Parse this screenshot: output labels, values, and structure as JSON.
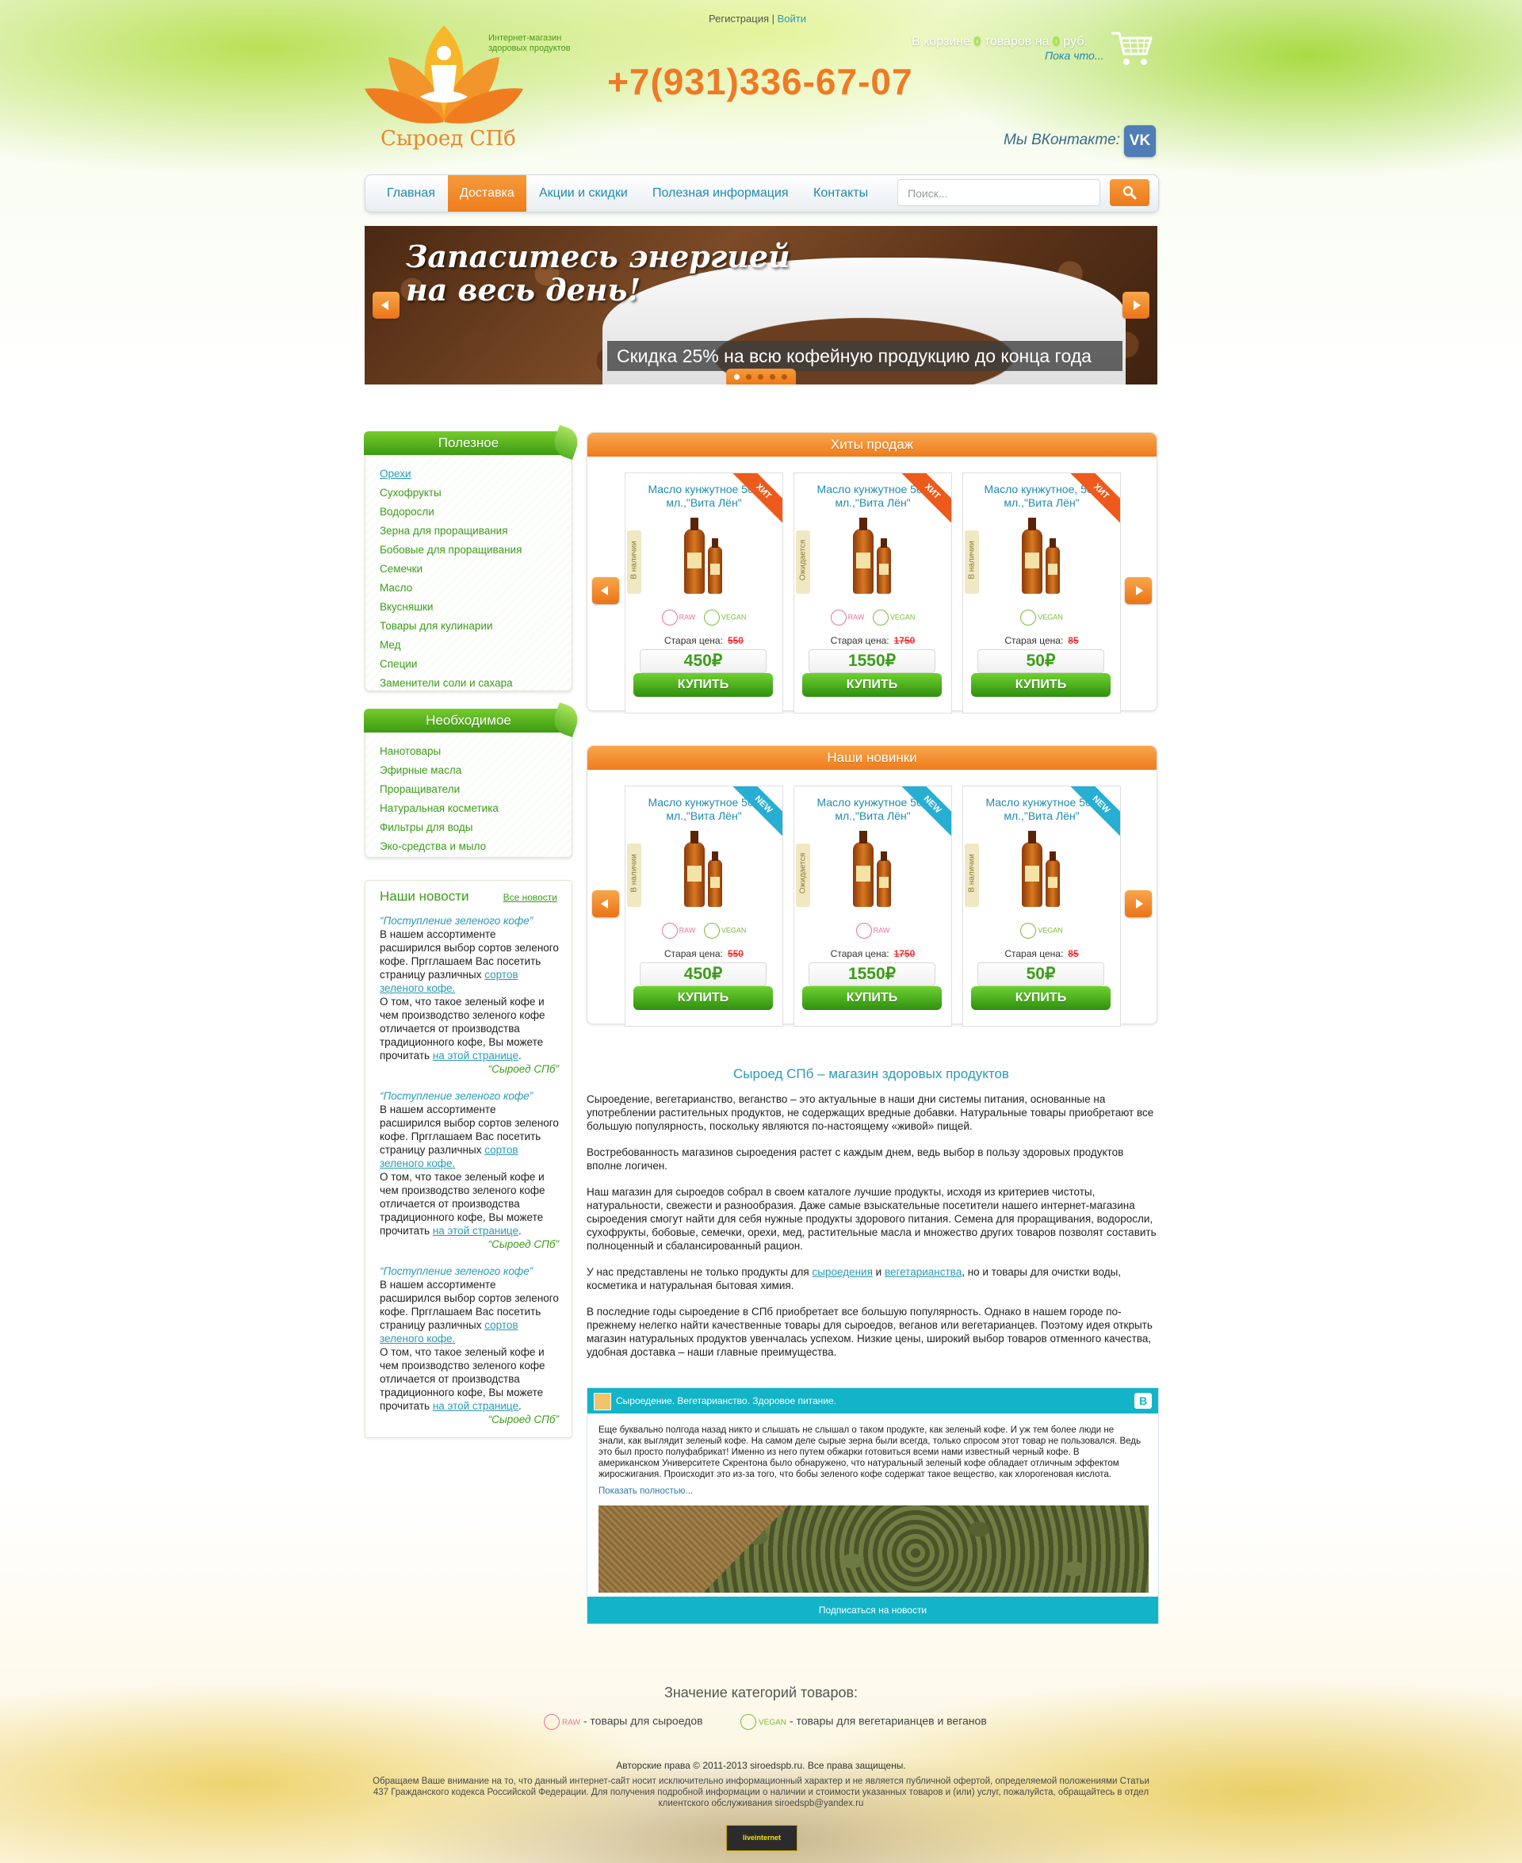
{
  "header": {
    "tagline": "Интернет-магазин здоровых продуктов",
    "brand_name": "Сыроед СПб",
    "register_label": "Регистрация",
    "separator": "|",
    "login_label": "Войти",
    "phone": "+7(931)336-67-07",
    "cart": {
      "prefix": "В корзине",
      "items_count": "0",
      "middle": "товаров на",
      "sum": "0",
      "suffix": "руб.",
      "subtext": "Пока что..."
    },
    "vk_label": "Мы ВКонтакте:",
    "vk_icon_text": "VK"
  },
  "nav": {
    "items": [
      {
        "label": "Главная"
      },
      {
        "label": "Доставка"
      },
      {
        "label": "Акции и скидки"
      },
      {
        "label": "Полезная информация"
      },
      {
        "label": "Контакты"
      }
    ],
    "active_index": 1,
    "search_placeholder": "Поиск..."
  },
  "banner": {
    "title_line1": "Запаситесь энергией",
    "title_line2": "на весь день!",
    "caption": "Скидка 25% на всю кофейную продукцию до конца года",
    "slide_count": 5,
    "active_slide": 0
  },
  "sidebar": {
    "useful": {
      "title": "Полезное",
      "items": [
        "Орехи",
        "Сухофрукты",
        "Водоросли",
        "Зерна для проращивания",
        "Бобовые для проращивания",
        "Семечки",
        "Масло",
        "Вкусняшки",
        "Товары для кулинарии",
        "Мед",
        "Специи",
        "Заменители соли и сахара"
      ]
    },
    "needed": {
      "title": "Необходимое",
      "items": [
        "Нанотовары",
        "Эфирные масла",
        "Проращиватели",
        "Натуральная косметика",
        "Фильтры для воды",
        "Эко-средства и мыло"
      ]
    },
    "news": {
      "title": "Наши новости",
      "all_link": "Все новости",
      "items": [
        {
          "headline": "“Поступление зеленого кофе”",
          "text1": "В нашем ассортименте расширился выбор сортов зеленого кофе. Пргглашаем Вас посетить страницу различных",
          "link1": "сортов зеленого кофе.",
          "text2": "О том, что такое зеленый кофе и чем производство зеленого кофе отличается от производства традиционного кофе, Вы можете прочитать",
          "link2": "на этой странице",
          "end": ".",
          "signature": "“Сыроед СПб”"
        },
        {
          "headline": "“Поступление зеленого кофе”",
          "text1": "В нашем ассортименте расширился выбор сортов зеленого кофе. Пргглашаем Вас посетить страницу различных",
          "link1": "сортов зеленого кофе.",
          "text2": "О том, что такое зеленый кофе и чем производство зеленого кофе отличается от производства традиционного кофе, Вы можете прочитать",
          "link2": "на этой странице",
          "end": ".",
          "signature": "“Сыроед СПб”"
        },
        {
          "headline": "“Поступление зеленого кофе”",
          "text1": "В нашем ассортименте расширился выбор сортов зеленого кофе. Пргглашаем Вас посетить страницу различных",
          "link1": "сортов зеленого кофе.",
          "text2": "О том, что такое зеленый кофе и чем производство зеленого кофе отличается от производства традиционного кофе, Вы можете прочитать",
          "link2": "на этой странице",
          "end": ".",
          "signature": "“Сыроед СПб”"
        }
      ]
    }
  },
  "bestsellers": {
    "title": "Хиты продаж",
    "products": [
      {
        "name": "Масло кунжутное 500 мл.,\"Вита Лён\"",
        "ribbon": "ХИТ",
        "availability": "В наличии",
        "tags": [
          "RAW",
          "VEGAN"
        ],
        "old_price_label": "Старая цена:",
        "old_price": "550",
        "price": "450₽",
        "buy_label": "КУПИТЬ"
      },
      {
        "name": "Масло кунжутное 500 мл.,\"Вита Лён\"",
        "ribbon": "ХИТ",
        "availability": "Ожидается",
        "tags": [
          "RAW",
          "VEGAN"
        ],
        "old_price_label": "Старая цена:",
        "old_price": "1750",
        "price": "1550₽",
        "buy_label": "КУПИТЬ"
      },
      {
        "name": "Масло кунжутное, 500 мл.,\"Вита Лён\"",
        "ribbon": "ХИТ",
        "availability": "В наличии",
        "tags": [
          "VEGAN"
        ],
        "old_price_label": "Старая цена:",
        "old_price": "85",
        "price": "50₽",
        "buy_label": "КУПИТЬ"
      }
    ]
  },
  "new_products": {
    "title": "Наши новинки",
    "products": [
      {
        "name": "Масло кунжутное 500 мл.,\"Вита Лён\"",
        "ribbon": "NEW",
        "availability": "В наличии",
        "tags": [
          "RAW",
          "VEGAN"
        ],
        "old_price_label": "Старая цена:",
        "old_price": "550",
        "price": "450₽",
        "buy_label": "КУПИТЬ"
      },
      {
        "name": "Масло кунжутное 500 мл.,\"Вита Лён\"",
        "ribbon": "NEW",
        "availability": "Ожидается",
        "tags": [
          "RAW"
        ],
        "old_price_label": "Старая цена:",
        "old_price": "1750",
        "price": "1550₽",
        "buy_label": "КУПИТЬ"
      },
      {
        "name": "Масло кунжутное 500 мл.,\"Вита Лён\"",
        "ribbon": "NEW",
        "availability": "В наличии",
        "tags": [
          "VEGAN"
        ],
        "old_price_label": "Старая цена:",
        "old_price": "85",
        "price": "50₽",
        "buy_label": "КУПИТЬ"
      }
    ]
  },
  "about": {
    "title": "Сыроед СПб – магазин здоровых продуктов",
    "p1": "Сыроедение, вегетарианство, веганство – это актуальные в наши дни системы питания, основанные на употреблении растительных продуктов, не содержащих вредные добавки. Натуральные товары приобретают все большую популярность, поскольку являются по-настоящему «живой» пищей.",
    "p2": "Востребованность магазинов сыроедения растет с каждым днем, ведь выбор в пользу здоровых продуктов вполне логичен.",
    "p3": "Наш магазин для сыроедов собрал в своем каталоге лучшие продукты, исходя из критериев чистоты, натуральности, свежести и разнообразия. Даже самые взыскательные посетители нашего интернет-магазина сыроедения смогут найти для себя нужные продукты здорового питания. Семена для проращивания, водоросли, сухофрукты, бобовые, семечки, орехи, мед, растительные масла и множество других товаров позволят составить полноценный и сбалансированный рацион.",
    "p4_start": "У нас представлены не только продукты для",
    "p4_link1": "сыроедения",
    "p4_and": "и",
    "p4_link2": "вегетарианства",
    "p4_end": ", но и товары для очистки воды, косметика и натуральная бытовая химия.",
    "p5": "В последние годы сыроедение в СПб приобретает все большую популярность. Однако в нашем городе по-прежнему нелегко найти качественные товары для сыроедов, веганов или вегетарианцев. Поэтому идея открыть магазин натуральных продуктов увенчалась успехом. Низкие цены, широкий выбор товаров отменного качества, удобная доставка – наши главные преимущества."
  },
  "vk_widget": {
    "group_name": "Сыроедение. Вегетарианство. Здоровое питание.",
    "logo_text": "В",
    "post_text": "Еще буквально полгода назад никто и слышать не слышал о таком продукте, как зеленый кофе. И уж тем более люди не знали, как выглядит зеленый кофе. На самом деле сырые зерна были всегда, только спросом этот товар не пользовался. Ведь это был просто полуфабрикат! Именно из него путем обжарки готовиться всеми нами известный черный кофе. В американском Университете Скрентона было обнаружено, что натуральный зеленый кофе обладает отличным эффектом жиросжигания. Происходит это из-за того, что бобы зеленого кофе содержат такое вещество, как хлорогеновая кислота.",
    "more_link": "Показать полностью...",
    "subscribe_label": "Подписаться на новости"
  },
  "footer": {
    "legend_title": "Значение категорий товаров:",
    "raw_tag": "RAW",
    "raw_text": " - товары для сыроедов",
    "vegan_tag": "VEGAN",
    "vegan_text": " - товары для вегетарианцев и веганов",
    "copyright": "Авторские права © 2011-2013 siroedspb.ru. Все права защищены.",
    "disclaimer": "Обращаем Ваше внимание на то, что данный интернет-сайт носит исключительно информационный характер и не является публичной офертой, определяемой положениями Статьи 437 Гражданского кодекса Российской Федерации. Для получения подробной информации о наличии и стоимости указанных товаров и (или) услуг, пожалуйста, обращайтесь в отдел клиентского обслуживания siroedspb@yandex.ru",
    "counter_label": "liveinternet"
  },
  "colors": {
    "orange": "#ee7d1c",
    "green": "#3c9d1a",
    "blue": "#2a9ab8",
    "vk_teal": "#13b4c8"
  }
}
